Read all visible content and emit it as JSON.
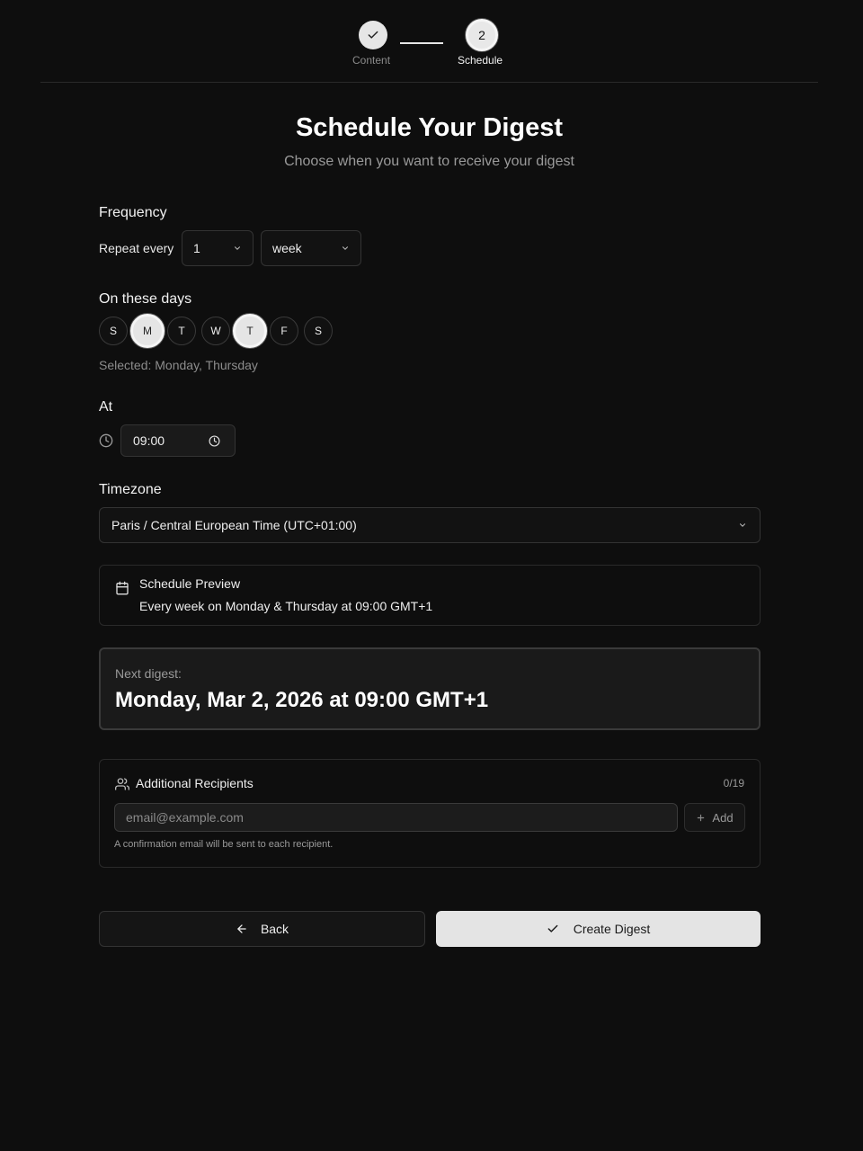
{
  "stepper": {
    "steps": [
      {
        "label": "Content",
        "state": "completed",
        "icon": "check-icon"
      },
      {
        "label": "Schedule",
        "state": "current",
        "number": "2"
      }
    ]
  },
  "header": {
    "title": "Schedule Your Digest",
    "subtitle": "Choose when you want to receive your digest"
  },
  "frequency": {
    "label": "Frequency",
    "repeat_text": "Repeat every",
    "interval_value": "1",
    "unit_value": "week"
  },
  "days": {
    "label": "On these days",
    "items": [
      {
        "letter": "S",
        "selected": false
      },
      {
        "letter": "M",
        "selected": true
      },
      {
        "letter": "T",
        "selected": false
      },
      {
        "letter": "W",
        "selected": false
      },
      {
        "letter": "T",
        "selected": true
      },
      {
        "letter": "F",
        "selected": false
      },
      {
        "letter": "S",
        "selected": false
      }
    ],
    "selected_text": "Selected: Monday, Thursday"
  },
  "time": {
    "label": "At",
    "value": "09:00"
  },
  "timezone": {
    "label": "Timezone",
    "value": "Paris / Central European Time (UTC+01:00)"
  },
  "preview": {
    "title": "Schedule Preview",
    "text": "Every week on Monday & Thursday at 09:00 GMT+1"
  },
  "next_digest": {
    "label": "Next digest:",
    "value": "Monday, Mar 2, 2026 at 09:00 GMT+1"
  },
  "recipients": {
    "title": "Additional Recipients",
    "count": "0/19",
    "placeholder": "email@example.com",
    "add_label": "Add",
    "note": "A confirmation email will be sent to each recipient."
  },
  "actions": {
    "back_label": "Back",
    "create_label": "Create Digest"
  },
  "colors": {
    "background": "#0e0e0e",
    "primary_button": "#e4e4e4",
    "muted_text": "#9a9a9a"
  }
}
